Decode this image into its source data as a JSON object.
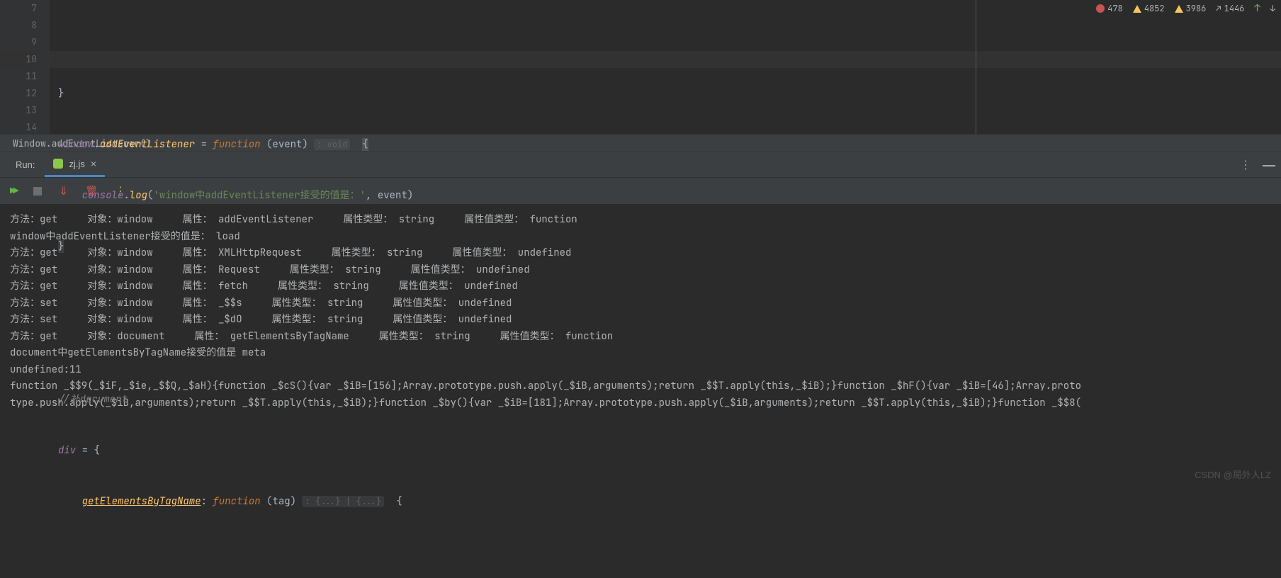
{
  "gutter_lines": [
    "7",
    "8",
    "9",
    "10",
    "",
    "11",
    "12",
    "13",
    "14"
  ],
  "code_lines": [
    {
      "indent": 0,
      "type": "close_brace",
      "content": "}"
    },
    {
      "indent": 0,
      "type": "line8"
    },
    {
      "indent": 1,
      "type": "line9"
    },
    {
      "indent": 0,
      "type": "line10"
    },
    {
      "indent": 0,
      "type": "blank"
    },
    {
      "indent": 0,
      "type": "blank"
    },
    {
      "indent": 0,
      "type": "comment",
      "content": "//补document"
    },
    {
      "indent": 0,
      "type": "line13"
    },
    {
      "indent": 1,
      "type": "line14"
    }
  ],
  "line8": {
    "obj": "window",
    "dot": ".",
    "method": "addEventListener",
    "eq": " = ",
    "kw": "function",
    "open": " (",
    "param": "event",
    "close": ") ",
    "hint": ": void",
    "space": "  ",
    "brace": "{"
  },
  "line9": {
    "indent": "    ",
    "obj": "console",
    "dot": ".",
    "method": "log",
    "open": "(",
    "str": "'window中addEventListener接受的值是：'",
    "comma": ", ",
    "param": "event",
    "close": ")"
  },
  "line10": {
    "brace": "}"
  },
  "line13": {
    "obj": "div",
    "eq": " = {"
  },
  "line14": {
    "indent": "    ",
    "method": "getElementsByTagName",
    "colon": ": ",
    "kw": "function",
    "open": " (",
    "param": "tag",
    "close": ") ",
    "hint": ": {...} | {...}",
    "space": "  ",
    "brace": "{"
  },
  "status": {
    "errors": "478",
    "warnings1": "4852",
    "warnings2": "3986",
    "inspections": "1446"
  },
  "breadcrumb": "Window.addEventListener()",
  "run_tab": {
    "run_label": "Run",
    "filename": "zj.js"
  },
  "console_lines": [
    "方法：get     对象：window     属性： addEventListener     属性类型： string     属性值类型： function",
    "window中addEventListener接受的值是： load",
    "方法：get     对象：window     属性： XMLHttpRequest     属性类型： string     属性值类型： undefined",
    "方法：get     对象：window     属性： Request     属性类型： string     属性值类型： undefined",
    "方法：get     对象：window     属性： fetch     属性类型： string     属性值类型： undefined",
    "方法：set     对象：window     属性： _$$s     属性类型： string     属性值类型： undefined",
    "方法：set     对象：window     属性： _$dO     属性类型： string     属性值类型： undefined",
    "方法：get     对象：document     属性： getElementsByTagName     属性类型： string     属性值类型： function",
    "document中getElementsByTagName接受的值是 meta",
    "undefined:11",
    "function _$$9(_$iF,_$ie,_$$Q,_$aH){function _$cS(){var _$iB=[156];Array.prototype.push.apply(_$iB,arguments);return _$$T.apply(this,_$iB);}function _$hF(){var _$iB=[46];Array.proto",
    "type.push.apply(_$iB,arguments);return _$$T.apply(this,_$iB);}function _$by(){var _$iB=[181];Array.prototype.push.apply(_$iB,arguments);return _$$T.apply(this,_$iB);}function _$$8("
  ],
  "watermark": "CSDN @局外人LZ"
}
